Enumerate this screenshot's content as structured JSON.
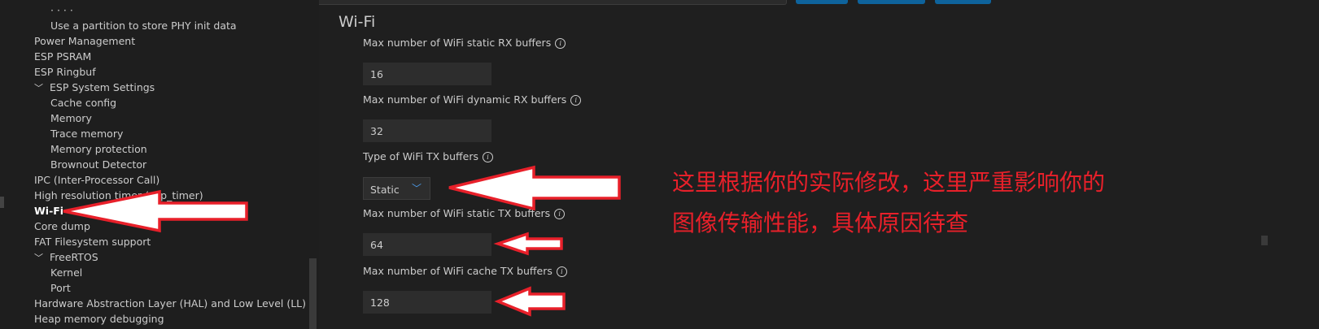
{
  "sidebar": {
    "items": [
      {
        "label": "· · · ·",
        "indent": 2,
        "expandable": false,
        "bold": false
      },
      {
        "label": "Use a partition to store PHY init data",
        "indent": 2,
        "expandable": false,
        "bold": false
      },
      {
        "label": "Power Management",
        "indent": 1,
        "expandable": false,
        "bold": false
      },
      {
        "label": "ESP PSRAM",
        "indent": 1,
        "expandable": false,
        "bold": false
      },
      {
        "label": "ESP Ringbuf",
        "indent": 1,
        "expandable": false,
        "bold": false
      },
      {
        "label": "ESP System Settings",
        "indent": 1,
        "expandable": true,
        "bold": false
      },
      {
        "label": "Cache config",
        "indent": 2,
        "expandable": false,
        "bold": false
      },
      {
        "label": "Memory",
        "indent": 2,
        "expandable": false,
        "bold": false
      },
      {
        "label": "Trace memory",
        "indent": 2,
        "expandable": false,
        "bold": false
      },
      {
        "label": "Memory protection",
        "indent": 2,
        "expandable": false,
        "bold": false
      },
      {
        "label": "Brownout Detector",
        "indent": 2,
        "expandable": false,
        "bold": false
      },
      {
        "label": "IPC (Inter-Processor Call)",
        "indent": 1,
        "expandable": false,
        "bold": false
      },
      {
        "label": "High resolution timer (esp_timer)",
        "indent": 1,
        "expandable": false,
        "bold": false
      },
      {
        "label": "Wi-Fi",
        "indent": 1,
        "expandable": false,
        "bold": true
      },
      {
        "label": "Core dump",
        "indent": 1,
        "expandable": false,
        "bold": false
      },
      {
        "label": "FAT Filesystem support",
        "indent": 1,
        "expandable": false,
        "bold": false
      },
      {
        "label": "FreeRTOS",
        "indent": 1,
        "expandable": true,
        "bold": false
      },
      {
        "label": "Kernel",
        "indent": 2,
        "expandable": false,
        "bold": false
      },
      {
        "label": "Port",
        "indent": 2,
        "expandable": false,
        "bold": false
      },
      {
        "label": "Hardware Abstraction Layer (HAL) and Low Level (LL)",
        "indent": 1,
        "expandable": false,
        "bold": false
      },
      {
        "label": "Heap memory debugging",
        "indent": 1,
        "expandable": false,
        "bold": false
      }
    ],
    "chevron": "chevron-down-icon"
  },
  "main": {
    "section_title": "Wi-Fi",
    "fields": {
      "static_rx": {
        "label": "Max number of WiFi static RX buffers",
        "value": "16"
      },
      "dynamic_rx": {
        "label": "Max number of WiFi dynamic RX buffers",
        "value": "32"
      },
      "tx_type": {
        "label": "Type of WiFi TX buffers",
        "value": "Static"
      },
      "static_tx": {
        "label": "Max number of WiFi static TX buffers",
        "value": "64"
      },
      "cache_tx": {
        "label": "Max number of WiFi cache TX buffers",
        "value": "128"
      }
    },
    "info_icon": "i"
  },
  "annotation": {
    "line1": "这里根据你的实际修改，这里严重影响你的",
    "line2": "图像传输性能，具体原因待查",
    "color": "#e8202a"
  },
  "colors": {
    "accent": "#0e639c",
    "background": "#1f1f1f",
    "annotation_red": "#e8202a"
  }
}
